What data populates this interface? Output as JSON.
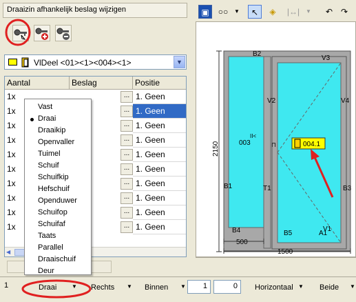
{
  "dialog": {
    "title": "Draaizin afhankelijk beslag wijzigen"
  },
  "toolbar": {
    "buttons": [
      {
        "icon": "key-icon",
        "selected": true
      },
      {
        "icon": "key-add-icon"
      },
      {
        "icon": "key-remove-icon"
      }
    ]
  },
  "part_select": {
    "value": "VlDeel <01><1><004><1>"
  },
  "grid": {
    "columns": [
      "Aantal",
      "Beslag",
      "Positie"
    ],
    "rows": [
      {
        "aantal": "1x",
        "positie": "1. Geen"
      },
      {
        "aantal": "1x",
        "positie": "1. Geen",
        "selected": true
      },
      {
        "aantal": "1x",
        "positie": "1. Geen"
      },
      {
        "aantal": "1x",
        "positie": "1. Geen"
      },
      {
        "aantal": "1x",
        "positie": "1. Geen"
      },
      {
        "aantal": "1x",
        "positie": "1. Geen"
      },
      {
        "aantal": "1x",
        "positie": "1. Geen"
      },
      {
        "aantal": "1x",
        "positie": "1. Geen"
      },
      {
        "aantal": "1x",
        "positie": "1. Geen"
      },
      {
        "aantal": "1x",
        "positie": "1. Geen"
      }
    ],
    "ellipsis": "..."
  },
  "menu": {
    "items": [
      "Vast",
      "Draai",
      "Draaikip",
      "Openvaller",
      "Tuimel",
      "Schuif",
      "Schuifkip",
      "Hefschuif",
      "Openduwer",
      "Schuifop",
      "Schuifaf",
      "Taats",
      "Parallel",
      "Draaischuif",
      "Deur"
    ],
    "checked": "Draai"
  },
  "drawing": {
    "labels": {
      "b2": "B2",
      "v3": "V3",
      "v2": "V2",
      "v4": "V4",
      "b1": "B1",
      "t1": "T1",
      "b3": "B3",
      "b4": "B4",
      "b5": "B5",
      "a1": "A1",
      "v1": "V1",
      "glass_left": "003",
      "glass_arrow": "II<",
      "tag": "004.1"
    },
    "dims": {
      "height": "2150",
      "left_width": "500",
      "total_width": "1500"
    },
    "colors": {
      "glass": "#3fe8f0",
      "frame": "#a8a8a8",
      "tag": "#ffff00",
      "arrow": "#e02020"
    }
  },
  "statusbar": {
    "index": "1",
    "draairichting": "Draai",
    "zijde": "Rechts",
    "positie": "Binnen",
    "val1": "1",
    "val2": "0",
    "richting": "Horizontaal",
    "beide": "Beide"
  }
}
